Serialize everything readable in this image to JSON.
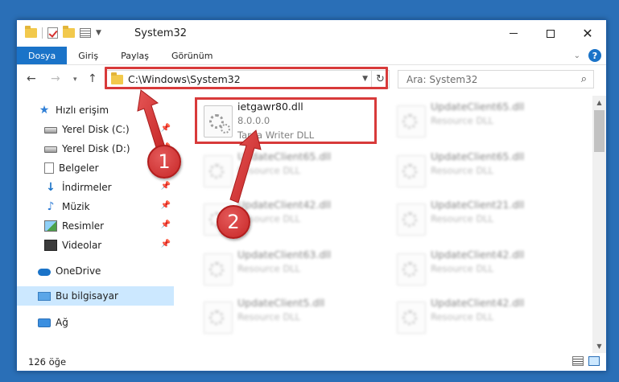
{
  "window": {
    "title": "System32",
    "controls": {
      "minimize": "minimize",
      "maximize": "maximize",
      "close": "close"
    }
  },
  "ribbon": {
    "tabs": [
      {
        "label": "Dosya",
        "active": true
      },
      {
        "label": "Giriş",
        "active": false
      },
      {
        "label": "Paylaş",
        "active": false
      },
      {
        "label": "Görünüm",
        "active": false
      }
    ],
    "help_label": "?"
  },
  "address": {
    "path": "C:\\Windows\\System32",
    "search_placeholder": "Ara: System32"
  },
  "sidebar": {
    "items": [
      {
        "label": "Hızlı erişim",
        "icon": "star-icon"
      },
      {
        "label": "Yerel Disk (C:)",
        "icon": "disk-icon",
        "pinned": true
      },
      {
        "label": "Yerel Disk (D:)",
        "icon": "disk-icon",
        "pinned": true
      },
      {
        "label": "Belgeler",
        "icon": "document-icon",
        "pinned": true
      },
      {
        "label": "İndirmeler",
        "icon": "download-icon",
        "pinned": true
      },
      {
        "label": "Müzik",
        "icon": "music-icon",
        "pinned": true
      },
      {
        "label": "Resimler",
        "icon": "pictures-icon",
        "pinned": true
      },
      {
        "label": "Videolar",
        "icon": "videos-icon",
        "pinned": true
      },
      {
        "label": "OneDrive",
        "icon": "cloud-icon"
      },
      {
        "label": "Bu bilgisayar",
        "icon": "computer-icon",
        "selected": true
      },
      {
        "label": "Ağ",
        "icon": "network-icon"
      }
    ]
  },
  "files": {
    "highlighted": {
      "name": "ietgawr80.dll",
      "version": "8.0.0.0",
      "description": "Targa Writer DLL"
    },
    "blurred": [
      {
        "name": "UpdateClient65.dll",
        "description": "Resource DLL"
      },
      {
        "name": "UpdateClient65.dll",
        "description": "Resource DLL"
      },
      {
        "name": "UpdateClient65.dll",
        "description": "Resource DLL"
      },
      {
        "name": "UpdateClient42.dll",
        "description": "Resource DLL"
      },
      {
        "name": "UpdateClient21.dll",
        "description": "Resource DLL"
      },
      {
        "name": "UpdateClient63.dll",
        "description": "Resource DLL"
      },
      {
        "name": "UpdateClient42.dll",
        "description": "Resource DLL"
      },
      {
        "name": "UpdateClient5.dll",
        "description": "Resource DLL"
      },
      {
        "name": "UpdateClient42.dll",
        "description": "Resource DLL"
      }
    ]
  },
  "status": {
    "item_count": "126 öğe"
  },
  "callouts": {
    "step1": "1",
    "step2": "2",
    "color": "#d83a3a"
  }
}
